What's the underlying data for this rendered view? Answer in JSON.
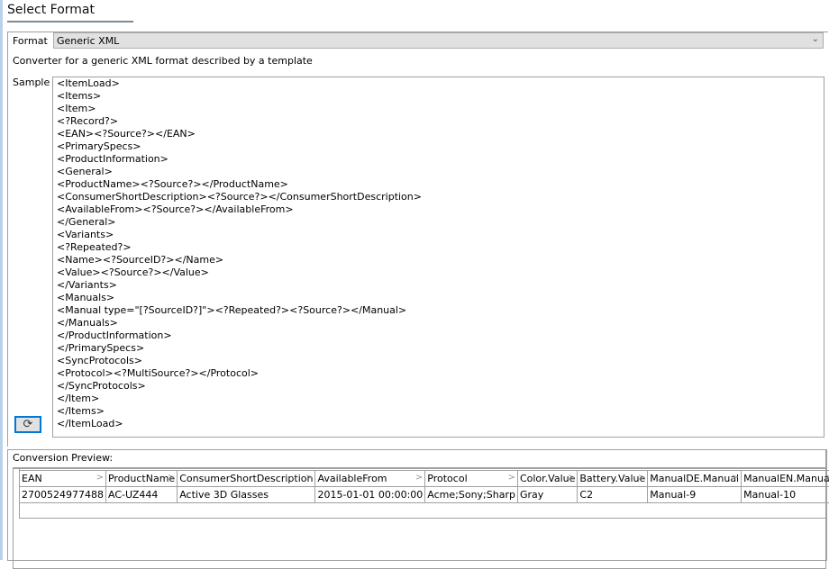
{
  "title": "Select Format",
  "format": {
    "label": "Format",
    "value": "Generic XML",
    "description": "Converter for a generic XML format described by a template"
  },
  "sample": {
    "label": "Sample",
    "lines": [
      "<ItemLoad>",
      "<Items>",
      "<Item>",
      "<?Record?>",
      "<EAN><?Source?></EAN>",
      "<PrimarySpecs>",
      "<ProductInformation>",
      "<General>",
      "<ProductName><?Source?></ProductName>",
      "<ConsumerShortDescription><?Source?></ConsumerShortDescription>",
      "<AvailableFrom><?Source?></AvailableFrom>",
      "</General>",
      "<Variants>",
      "<?Repeated?>",
      "<Name><?SourceID?></Name>",
      "<Value><?Source?></Value>",
      "</Variants>",
      "<Manuals>",
      "<Manual type=\"[?SourceID?]\"><?Repeated?><?Source?></Manual>",
      "</Manuals>",
      "</ProductInformation>",
      "</PrimarySpecs>",
      "<SyncProtocols>",
      "<Protocol><?MultiSource?></Protocol>",
      "</SyncProtocols>",
      "</Item>",
      "</Items>",
      "</ItemLoad>"
    ]
  },
  "preview": {
    "label": "Conversion Preview:",
    "columns": [
      "EAN",
      "ProductName",
      "ConsumerShortDescription",
      "AvailableFrom",
      "Protocol",
      "Color.Value",
      "Battery.Value",
      "ManualDE.Manual",
      "ManualEN.Manual"
    ],
    "rows": [
      [
        "2700524977488",
        "AC-UZ444",
        "Active 3D Glasses",
        "2015-01-01 00:00:00",
        "Acme;Sony;Sharp",
        "Gray",
        "C2",
        "Manual-9",
        "Manual-10"
      ]
    ]
  }
}
